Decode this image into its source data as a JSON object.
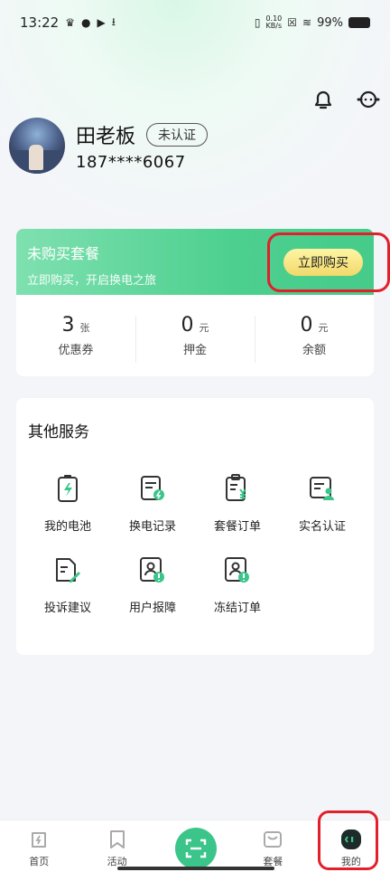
{
  "status_bar": {
    "time": "13:22",
    "speed_value": "0.10",
    "speed_unit": "KB/s",
    "battery": "99%"
  },
  "profile": {
    "name": "田老板",
    "verify_badge": "未认证",
    "phone": "187****6067"
  },
  "package": {
    "title": "未购买套餐",
    "subtitle": "立即购买，开启换电之旅",
    "buy_label": "立即购买"
  },
  "stats": [
    {
      "value": "3",
      "unit": "张",
      "label": "优惠券"
    },
    {
      "value": "0",
      "unit": "元",
      "label": "押金"
    },
    {
      "value": "0",
      "unit": "元",
      "label": "余额"
    }
  ],
  "services": {
    "title": "其他服务",
    "items": [
      {
        "label": "我的电池",
        "icon": "battery-icon"
      },
      {
        "label": "换电记录",
        "icon": "swap-record-icon"
      },
      {
        "label": "套餐订单",
        "icon": "package-order-icon"
      },
      {
        "label": "实名认证",
        "icon": "id-verify-icon"
      },
      {
        "label": "投诉建议",
        "icon": "complaint-icon"
      },
      {
        "label": "用户报障",
        "icon": "report-fault-icon"
      },
      {
        "label": "冻结订单",
        "icon": "freeze-order-icon"
      }
    ]
  },
  "tabbar": {
    "items": [
      {
        "label": "首页",
        "icon": "home-icon"
      },
      {
        "label": "活动",
        "icon": "activity-icon"
      },
      {
        "label": "",
        "icon": "scan-icon"
      },
      {
        "label": "套餐",
        "icon": "package-icon"
      },
      {
        "label": "我的",
        "icon": "mine-icon"
      }
    ]
  },
  "colors": {
    "accent": "#3cc58a",
    "highlight": "#e1202b",
    "buy_button": "#f3d86a"
  }
}
